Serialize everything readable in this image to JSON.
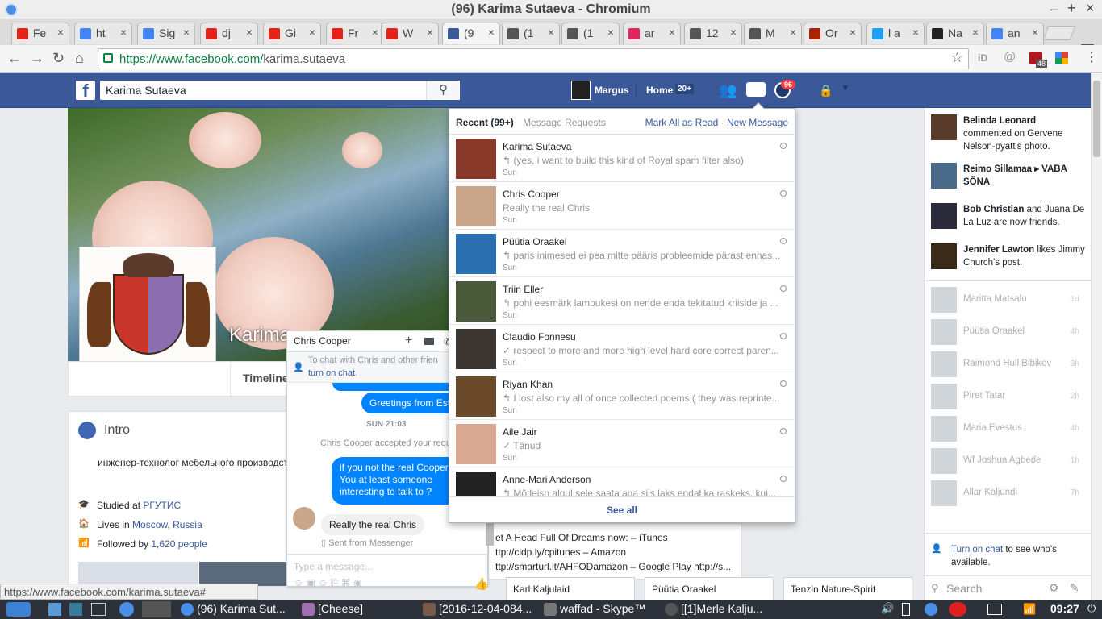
{
  "window": {
    "title": "(96) Karima Sutaeva - Chromium",
    "controls": [
      "–",
      "+",
      "×"
    ]
  },
  "tabs": [
    {
      "label": "Fe",
      "icon": "youtube-icon",
      "color": "#e62117"
    },
    {
      "label": "ht",
      "icon": "google-icon",
      "color": "#4285f4"
    },
    {
      "label": "Sig",
      "icon": "google-icon",
      "color": "#4285f4"
    },
    {
      "label": "dj",
      "icon": "youtube-icon",
      "color": "#e62117"
    },
    {
      "label": "Gi",
      "icon": "youtube-icon",
      "color": "#e62117"
    },
    {
      "label": "Fr",
      "icon": "youtube-icon",
      "color": "#e62117"
    },
    {
      "label": "W",
      "icon": "youtube-icon",
      "color": "#e62117"
    },
    {
      "label": "(9",
      "icon": "facebook-icon",
      "color": "#3b5998"
    },
    {
      "label": "(1",
      "icon": "page-icon",
      "color": "#555555"
    },
    {
      "label": "(1",
      "icon": "page-icon",
      "color": "#555555"
    },
    {
      "label": "ar",
      "icon": "heart-icon",
      "color": "#e0245e"
    },
    {
      "label": "12",
      "icon": "page-icon",
      "color": "#555555"
    },
    {
      "label": "M",
      "icon": "page-icon",
      "color": "#555555"
    },
    {
      "label": "Or",
      "icon": "q-icon",
      "color": "#a82400"
    },
    {
      "label": "l a",
      "icon": "star-icon",
      "color": "#1da1f2"
    },
    {
      "label": "Na",
      "icon": "wikipedia-icon",
      "color": "#222222"
    },
    {
      "label": "an",
      "icon": "google-icon",
      "color": "#4285f4"
    }
  ],
  "address": {
    "url_host": "https://www.facebook.com/",
    "url_path": "karima.sutaeva",
    "ext_badge": "48"
  },
  "fb": {
    "search_value": "Karima Sutaeva",
    "user": "Margus",
    "home": "Home",
    "home_count": "20+",
    "notif_count": "96"
  },
  "profile": {
    "name": "Karima",
    "timeline_tab": "Timeline"
  },
  "intro": {
    "title": "Intro",
    "bio": "инженер-технолог мебельного производст",
    "studied_prefix": "Studied at ",
    "studied_link": "РГУТИС",
    "lives_prefix": "Lives in ",
    "lives_city": "Moscow",
    "lives_sep": ", ",
    "lives_country": "Russia",
    "followed_prefix": "Followed by ",
    "followed_link": "1,620 people"
  },
  "chat": {
    "name": "Chris Cooper",
    "notice": "To chat with Chris and other frien",
    "notice_link": "turn on chat",
    "notice_end": ".",
    "msg_greet": "Greetings from Est",
    "date_sep": "SUN 21:03",
    "accepted": "Chris Cooper accepted your requ",
    "msg_out_1": "if you not the real Cooper,",
    "msg_out_2": "You at least someone",
    "msg_out_3": "interesting to talk to ?",
    "msg_in": "Really the real Chris",
    "sent_from": "Sent from Messenger",
    "placeholder": "Type a message..."
  },
  "messages": {
    "recent_label": "Recent",
    "recent_count": "(99+)",
    "requests": "Message Requests",
    "mark_all": "Mark All as Read",
    "sep": " · ",
    "new_message": "New Message",
    "see_all": "See all",
    "items": [
      {
        "name": "Karima Sutaeva",
        "preview": "↰ (yes, i want to build this kind of Royal spam filter also)",
        "time": "Sun",
        "color": "#8a3a2a"
      },
      {
        "name": "Chris Cooper",
        "preview": "Really the real Chris",
        "time": "Sun",
        "color": "#c9a58a"
      },
      {
        "name": "Püütia Oraakel",
        "preview": "↰ paris inimesed ei pea mitte pääris probleemide pärast ennas...",
        "time": "Sun",
        "color": "#2a6fb0"
      },
      {
        "name": "Triin Eller",
        "preview": "↰ pohi eesmärk lambukesi on nende enda tekitatud kriiside ja ...",
        "time": "Sun",
        "color": "#4a5a3a"
      },
      {
        "name": "Claudio Fonnesu",
        "preview": "✓ respect to more and more high level hard core correct paren...",
        "time": "Sun",
        "color": "#3a3530"
      },
      {
        "name": "Riyan Khan",
        "preview": "↰ I lost also my all of once collected poems ( they was reprinte...",
        "time": "Sun",
        "color": "#6a4a2a"
      },
      {
        "name": "Aile Jair",
        "preview": "✓ Tänud",
        "time": "Sun",
        "color": "#d8a890"
      },
      {
        "name": "Anne-Mari Anderson",
        "preview": "↰ Mõtleisn algul sele saata aga siis laks endal ka raskeks, kui...",
        "time": "",
        "color": "#222222"
      }
    ]
  },
  "ticker": [
    {
      "bold": "Belinda Leonard",
      "rest": " commented on Gervene Nelson-pyatt's photo.",
      "color": "#5a3a2a"
    },
    {
      "bold": "Reimo Sillamaa ▸ VABA SÕNA",
      "rest": "",
      "color": "#4a6a8a"
    },
    {
      "bold": "Bob Christian",
      "rest": " and Juana De La Luz are now friends.",
      "color": "#2a2a3a"
    },
    {
      "bold": "Jennifer Lawton",
      "rest": " likes Jimmy Church's post.",
      "color": "#3a2a1a"
    }
  ],
  "contacts": [
    {
      "name": "Maritta Matsalu",
      "time": "1d"
    },
    {
      "name": "Püütia Oraakel",
      "time": "4h"
    },
    {
      "name": "Raimond Hull Bibikov",
      "time": "3h"
    },
    {
      "name": "Piret Tatar",
      "time": "2h"
    },
    {
      "name": "Maria Evestus",
      "time": "4h"
    },
    {
      "name": "Wf Joshua Agbede",
      "time": "1h"
    },
    {
      "name": "Allar Kaljundi",
      "time": "7h"
    }
  ],
  "sidebar_footer": {
    "turn_on": "Turn on chat",
    "rest": " to see who's",
    "rest2": "available.",
    "search": "Search"
  },
  "post": {
    "line1": "et A Head Full Of Dreams now: – iTunes",
    "line2": "ttp://cldp.ly/cpitunes – Amazon",
    "line3": "ttp://smarturl.it/AHFODamazon – Google Play http://s..."
  },
  "bottom_chats": [
    "Karl Kaljulaid",
    "Püütia Oraakel",
    "Tenzin Nature-Spirit"
  ],
  "status_url": "https://www.facebook.com/karima.sutaeva#",
  "taskbar": {
    "items": [
      "(96) Karima Sut...",
      "[Cheese]",
      "[2016-12-04-084...",
      "waffad - Skype™",
      "[[1]Merle Kalju..."
    ],
    "clock": "09:27"
  }
}
